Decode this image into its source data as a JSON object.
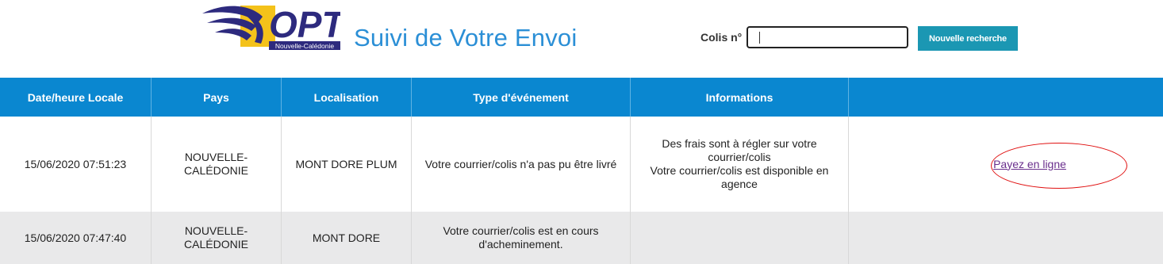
{
  "header": {
    "logo_text": "OPT",
    "logo_subtext": "Nouvelle-Calédonie",
    "title": "Suivi de Votre Envoi",
    "colis_label": "Colis n°",
    "colis_value": "",
    "search_button": "Nouvelle recherche"
  },
  "table": {
    "columns": [
      "Date/heure Locale",
      "Pays",
      "Localisation",
      "Type d'événement",
      "Informations",
      ""
    ],
    "rows": [
      {
        "date": "15/06/2020 07:51:23",
        "pays": "NOUVELLE-CALÉDONIE",
        "localisation": "MONT DORE PLUM",
        "type": "Votre courrier/colis n'a pas pu être livré",
        "informations": [
          "Des frais sont à régler sur votre courrier/colis",
          "Votre courrier/colis est disponible en agence"
        ],
        "action": "Payez en ligne"
      },
      {
        "date": "15/06/2020 07:47:40",
        "pays": "NOUVELLE-CALÉDONIE",
        "localisation": "MONT DORE",
        "type": "Votre courrier/colis est en cours d'acheminement.",
        "informations": [],
        "action": ""
      }
    ]
  },
  "colors": {
    "header_blue": "#0a87d0",
    "title_blue": "#2b8fd6",
    "button_teal": "#1b97b3",
    "link_purple": "#6a2f8d",
    "highlight_red": "#e01010"
  }
}
